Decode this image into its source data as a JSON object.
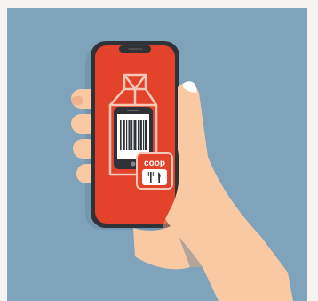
{
  "illustration": {
    "colors": {
      "outer_bg": "#f4f3ef",
      "panel_bg": "#7fa3bb",
      "phone_body": "#2f3338",
      "screen": "#e2432a",
      "hand_skin": "#f8c9a3",
      "hand_shadow": "#e8a57e",
      "fingernail": "#fdfdfd",
      "line_art": "#f5c8b8"
    },
    "badge": {
      "brand_text": "coop",
      "icon": "fork-knife-icon"
    },
    "screen_icons": [
      "milk-carton-icon",
      "smartphone-icon",
      "barcode-icon"
    ]
  }
}
